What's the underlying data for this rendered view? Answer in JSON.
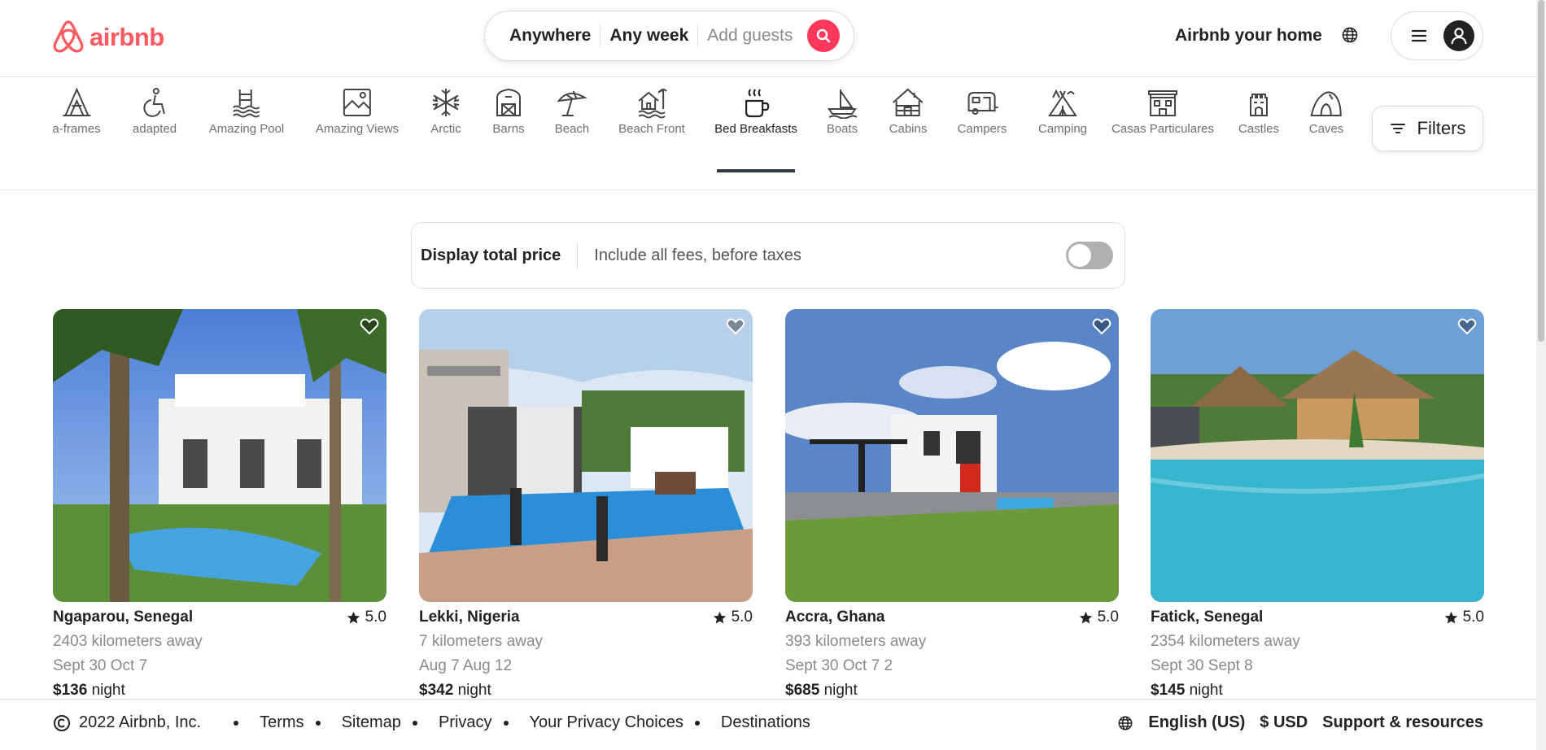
{
  "brand": {
    "name": "airbnb",
    "color": "#ff5a5f"
  },
  "search": {
    "where": "Anywhere",
    "when": "Any week",
    "guests": "Add guests",
    "button_color": "#ff385c"
  },
  "header": {
    "host_link": "Airbnb your home",
    "globe_icon": "globe-icon",
    "menu_icon": "hamburger-icon",
    "avatar_icon": "user-avatar-icon"
  },
  "categories": [
    {
      "label": "a-frames",
      "icon": "a-frame-icon"
    },
    {
      "label": "adapted",
      "icon": "wheelchair-icon"
    },
    {
      "label": "Amazing Pool",
      "icon": "pool-icon"
    },
    {
      "label": "Amazing Views",
      "icon": "landscape-frame-icon"
    },
    {
      "label": "Arctic",
      "icon": "snowflake-icon"
    },
    {
      "label": "Barns",
      "icon": "barn-icon"
    },
    {
      "label": "Beach",
      "icon": "umbrella-icon"
    },
    {
      "label": "Beach Front",
      "icon": "beach-house-icon"
    },
    {
      "label": "Bed Breakfasts",
      "icon": "coffee-mug-icon",
      "active": true
    },
    {
      "label": "Boats",
      "icon": "sailboat-icon"
    },
    {
      "label": "Cabins",
      "icon": "cabin-icon"
    },
    {
      "label": "Campers",
      "icon": "camper-icon"
    },
    {
      "label": "Camping",
      "icon": "tent-icon"
    },
    {
      "label": "Casas Particulares",
      "icon": "building-icon"
    },
    {
      "label": "Castles",
      "icon": "castle-icon"
    },
    {
      "label": "Caves",
      "icon": "cave-icon"
    }
  ],
  "filters": {
    "label": "Filters",
    "icon": "sliders-icon"
  },
  "total_price": {
    "title": "Display total price",
    "description": "Include all fees, before taxes",
    "enabled": false
  },
  "listings": [
    {
      "location": "Ngaparou, Senegal",
      "rating": "5.0",
      "distance": "2403 kilometers away",
      "dates": "Sept 30 Oct 7",
      "price": "$136",
      "unit": "night"
    },
    {
      "location": "Lekki, Nigeria",
      "rating": "5.0",
      "distance": "7 kilometers away",
      "dates": "Aug 7 Aug 12",
      "price": "$342",
      "unit": "night"
    },
    {
      "location": "Accra, Ghana",
      "rating": "5.0",
      "distance": "393 kilometers away",
      "dates": "Sept 30 Oct 7 2",
      "price": "$685",
      "unit": "night"
    },
    {
      "location": "Fatick, Senegal",
      "rating": "5.0",
      "distance": "2354 kilometers away",
      "dates": "Sept 30 Sept 8",
      "price": "$145",
      "unit": "night"
    }
  ],
  "footer": {
    "copyright": "2022 Airbnb, Inc.",
    "links": [
      "Terms",
      "Sitemap",
      "Privacy",
      "Your Privacy Choices",
      "Destinations"
    ],
    "language": "English (US)",
    "currency": "$ USD",
    "support": "Support & resources"
  }
}
